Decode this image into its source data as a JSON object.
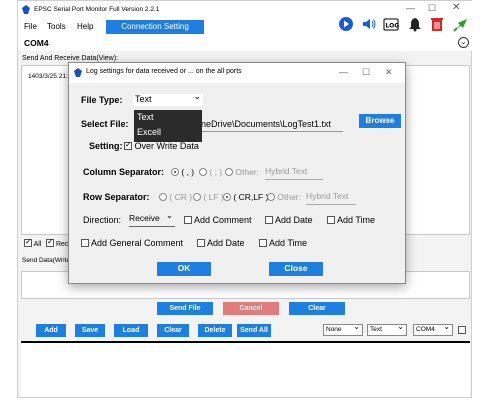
{
  "app": {
    "title": "EPSC Serial Port Monitor Full Version 2.2.1",
    "menu": [
      "File",
      "Tools",
      "Help"
    ],
    "connection_tab": "Connection Setting",
    "port": "COM4",
    "section_send_receive": "Send And Receive Data(View):",
    "log_line": "1403/3/25 21:2",
    "chk_all": "All",
    "chk_rec": "Rec",
    "section_send": "Send Data(Write",
    "send_buttons": {
      "send_file": "Send File",
      "cancel": "Cancel",
      "clear": "Clear"
    },
    "toolbar_buttons": [
      "Add",
      "Save",
      "Load",
      "Clear",
      "Delete",
      "Send All"
    ],
    "selects": {
      "a": "None",
      "b": "Text",
      "c": "COM4"
    },
    "accent_color": "#1e7fe0"
  },
  "dialog": {
    "title": "Log settings for data received or ... on the all ports",
    "file_type_label": "File Type:",
    "file_type_value": "Text",
    "file_type_options": [
      "Text",
      "Excell"
    ],
    "select_file_label": "Select File:",
    "file_path": "neDrive\\Documents\\LogTest1.txt",
    "browse": "Browse",
    "setting_label": "Setting:",
    "overwrite": "Over Write Data",
    "col_sep_label": "Column Separator:",
    "col_opts": [
      "( , )",
      "( ; )",
      "Other:"
    ],
    "col_placeholder": "Hybrid Text",
    "row_sep_label": "Row Separator:",
    "row_opts": [
      "( CR )",
      "( LF )",
      "( CR,LF )",
      "Other:"
    ],
    "row_placeholder": "Hybrid Text",
    "direction_label": "Direction:",
    "direction_value": "Receive",
    "add_comment": "Add Comment",
    "add_date": "Add Date",
    "add_time": "Add Time",
    "add_general_comment": "Add General Comment",
    "add_date2": "Add Date",
    "add_time2": "Add Time",
    "ok": "OK",
    "close": "Close"
  }
}
